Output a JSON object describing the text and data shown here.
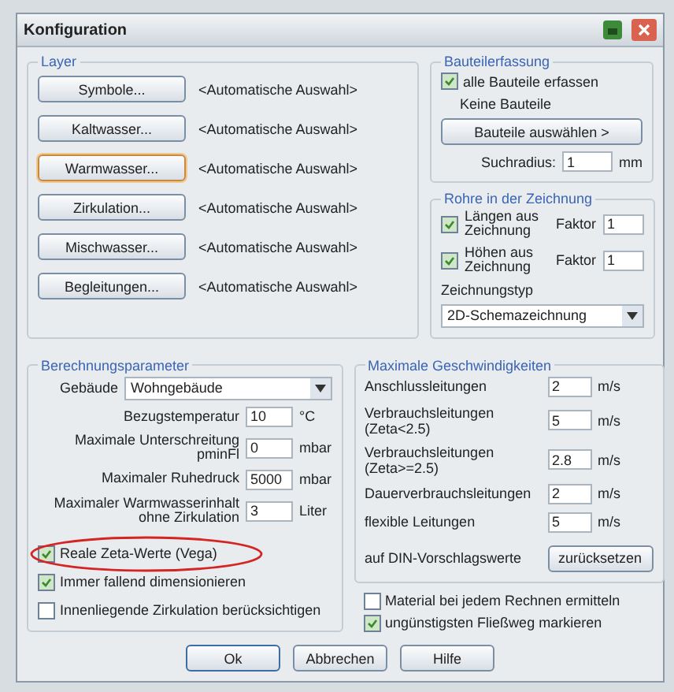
{
  "window": {
    "title": "Konfiguration"
  },
  "layer": {
    "title": "Layer",
    "items": [
      {
        "label": "Symbole...",
        "value": "<Automatische Auswahl>",
        "focused": false
      },
      {
        "label": "Kaltwasser...",
        "value": "<Automatische Auswahl>",
        "focused": false
      },
      {
        "label": "Warmwasser...",
        "value": "<Automatische Auswahl>",
        "focused": true
      },
      {
        "label": "Zirkulation...",
        "value": "<Automatische Auswahl>",
        "focused": false
      },
      {
        "label": "Mischwasser...",
        "value": "<Automatische Auswahl>",
        "focused": false
      },
      {
        "label": "Begleitungen...",
        "value": "<Automatische Auswahl>",
        "focused": false
      }
    ]
  },
  "bauteilerfassung": {
    "title": "Bauteilerfassung",
    "checkbox": {
      "label": "alle Bauteile erfassen",
      "checked": true
    },
    "info": "Keine Bauteile",
    "button": "Bauteile auswählen >",
    "radius_label": "Suchradius:",
    "radius_value": "1",
    "radius_unit": "mm"
  },
  "rohre": {
    "title": "Rohre in der Zeichnung",
    "items": [
      {
        "label": "Längen aus Zeichnung",
        "checked": true,
        "factor_label": "Faktor",
        "factor": "1"
      },
      {
        "label": "Höhen aus Zeichnung",
        "checked": true,
        "factor_label": "Faktor",
        "factor": "1"
      }
    ],
    "type_label": "Zeichnungstyp",
    "type_value": "2D-Schemazeichnung"
  },
  "berechnung": {
    "title": "Berechnungsparameter",
    "building_label": "Gebäude",
    "building_value": "Wohngebäude",
    "fields": [
      {
        "label": "Bezugstemperatur",
        "value": "10",
        "unit": "°C"
      },
      {
        "label": "Maximale Unterschreitung pminFl",
        "value": "0",
        "unit": "mbar"
      },
      {
        "label": "Maximaler Ruhedruck",
        "value": "5000",
        "unit": "mbar"
      },
      {
        "label": "Maximaler Warmwasserinhalt ohne Zirkulation",
        "value": "3",
        "unit": "Liter"
      }
    ],
    "options": [
      {
        "label": "Reale Zeta-Werte (Vega)",
        "checked": true
      },
      {
        "label": "Immer fallend dimensionieren",
        "checked": true
      },
      {
        "label": "Innenliegende Zirkulation berücksichtigen",
        "checked": false
      }
    ]
  },
  "geschwindigkeiten": {
    "title": "Maximale Geschwindigkeiten",
    "fields": [
      {
        "label": "Anschlussleitungen",
        "value": "2",
        "unit": "m/s"
      },
      {
        "label": "Verbrauchsleitungen (Zeta<2.5)",
        "value": "5",
        "unit": "m/s"
      },
      {
        "label": "Verbrauchsleitungen (Zeta>=2.5)",
        "value": "2.8",
        "unit": "m/s"
      },
      {
        "label": "Dauerverbrauchsleitungen",
        "value": "2",
        "unit": "m/s"
      },
      {
        "label": "flexible Leitungen",
        "value": "5",
        "unit": "m/s"
      }
    ],
    "reset_label": "auf DIN-Vorschlagswerte",
    "reset_button": "zurücksetzen"
  },
  "options": [
    {
      "label": "Material bei jedem Rechnen ermitteln",
      "checked": false
    },
    {
      "label": "ungünstigsten Fließweg markieren",
      "checked": true
    }
  ],
  "buttons": [
    "Ok",
    "Abbrechen",
    "Hilfe"
  ]
}
